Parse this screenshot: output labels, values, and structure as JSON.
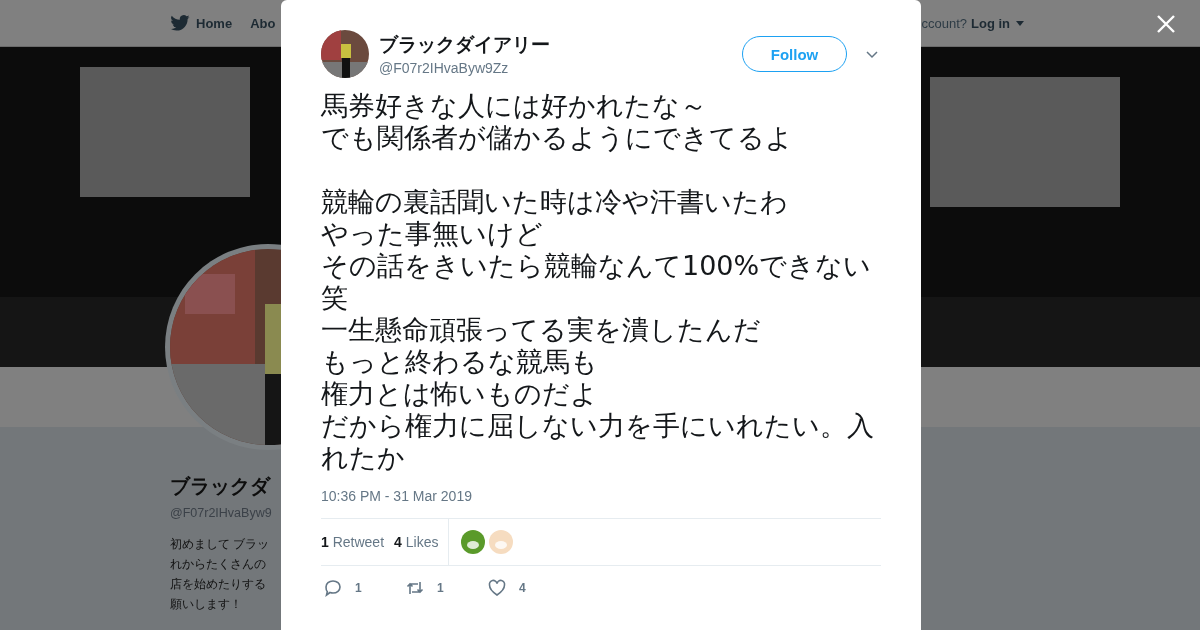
{
  "nav": {
    "left": [
      "Home",
      "Abo"
    ],
    "right": {
      "prompt": "ccount?",
      "login": "Log in"
    }
  },
  "profile": {
    "name": "ブラックダ",
    "handle": "@F07r2IHvaByw9",
    "bio_lines": [
      "初めまして ブラッ",
      "れからたくさんの",
      "店を始めたりする",
      "願いします！"
    ]
  },
  "tweet": {
    "author": "ブラックダイアリー",
    "handle": "@F07r2IHvaByw9Zz",
    "follow": "Follow",
    "paragraphs": [
      [
        "馬券好きな人には好かれたな～",
        "でも関係者が儲かるようにできてるよ"
      ],
      [
        "競輪の裏話聞いた時は冷や汗書いたわ",
        "やった事無いけど",
        "その話をきいたら競輪なんて100%できない笑",
        "一生懸命頑張ってる実を潰したんだ",
        "もっと終わるな競馬も",
        "権力とは怖いものだよ",
        "だから権力に屈しない力を手にいれたい。入れたか"
      ]
    ],
    "time": "10:36 PM - 31 Mar 2019",
    "stats": [
      {
        "count": "1",
        "label": "Retweet"
      },
      {
        "count": "4",
        "label": "Likes"
      }
    ],
    "likers": [
      {
        "color": "#5a9a2a"
      },
      {
        "color": "#f6dcc0"
      }
    ],
    "actions": [
      {
        "kind": "reply",
        "count": "1"
      },
      {
        "kind": "retweet",
        "count": "1"
      },
      {
        "kind": "like",
        "count": "4"
      }
    ]
  }
}
